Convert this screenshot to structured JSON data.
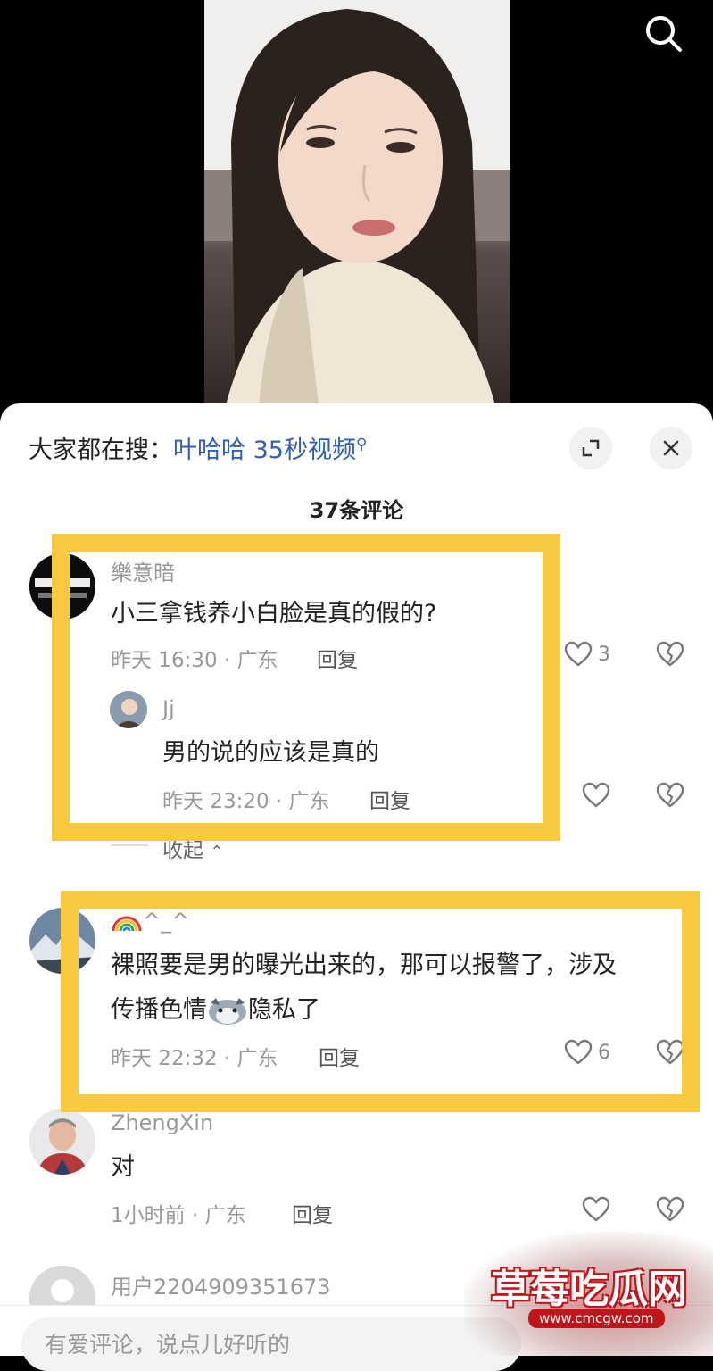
{
  "trending": {
    "prefix": "大家都在搜：",
    "keyword": "叶哈哈 35秒视频"
  },
  "comment_count": "37条评论",
  "comments": [
    {
      "user": "樂意暗",
      "text": "小三拿钱养小白脸是真的假的?",
      "time_loc": "昨天 16:30 · 广东",
      "reply": "回复",
      "likes": "3"
    },
    {
      "user": "Jj",
      "text": "男的说的应该是真的",
      "time_loc": "昨天 23:20 · 广东",
      "reply": "回复"
    },
    {
      "user": "^_^",
      "text1": "裸照要是男的曝光出来的，那可以报警了，涉及",
      "text2a": "传播色情",
      "text2b": "隐私了",
      "time_loc": "昨天 22:32 · 广东",
      "reply": "回复",
      "likes": "6"
    },
    {
      "user": "ZhengXin",
      "text": "对",
      "time_loc": "1小时前 · 广东",
      "reply": "回复"
    },
    {
      "user": "用户2204909351673"
    }
  ],
  "collapse_label": "收起",
  "input": {
    "placeholder": "有爱评论，说点儿好听的"
  },
  "watermark": {
    "name": "草莓吃瓜网",
    "url": "www.cmcgw.com"
  },
  "colors": {
    "highlight": "#f6c93e",
    "keyword": "#2f5fb3"
  },
  "icons": [
    "search-icon",
    "expand-icon",
    "close-icon",
    "heart-icon",
    "broken-heart-icon",
    "chevron-up-icon",
    "rainbow-emoji",
    "husky-emoji"
  ]
}
